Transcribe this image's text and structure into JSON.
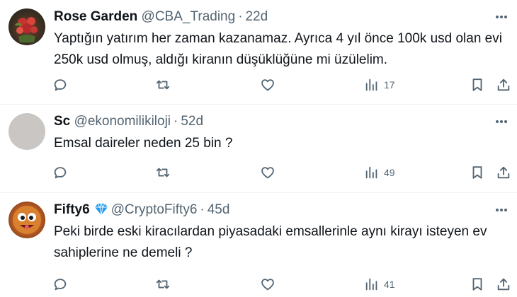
{
  "tweets": [
    {
      "name": "Rose Garden",
      "handle": "@CBA_Trading",
      "time": "22d",
      "text": "Yaptığın yatırım her zaman kazanamaz. Ayrıca 4 yıl önce 100k usd olan evi 250k usd olmuş, aldığı kiranın düşüklüğüne mi üzülelim.",
      "views": "17"
    },
    {
      "name": "Sc",
      "handle": "@ekonomilikiloji",
      "time": "52d",
      "text": "Emsal daireler neden 25 bin ?",
      "views": "49"
    },
    {
      "name": "Fifty6",
      "handle": "@CryptoFifty6",
      "time": "45d",
      "text": "Peki birde eski kiracılardan piyasadaki emsallerinle aynı kirayı isteyen ev sahiplerine ne demeli ?",
      "views": "41"
    }
  ],
  "separator": "·",
  "colors": {
    "text": "#0f1419",
    "secondary": "#536471",
    "divider": "#eff3f4",
    "verified": "#1d9bf0"
  },
  "icons": [
    "reply-icon",
    "retweet-icon",
    "like-icon",
    "views-icon",
    "bookmark-icon",
    "share-icon",
    "more-icon",
    "verified-icon"
  ]
}
